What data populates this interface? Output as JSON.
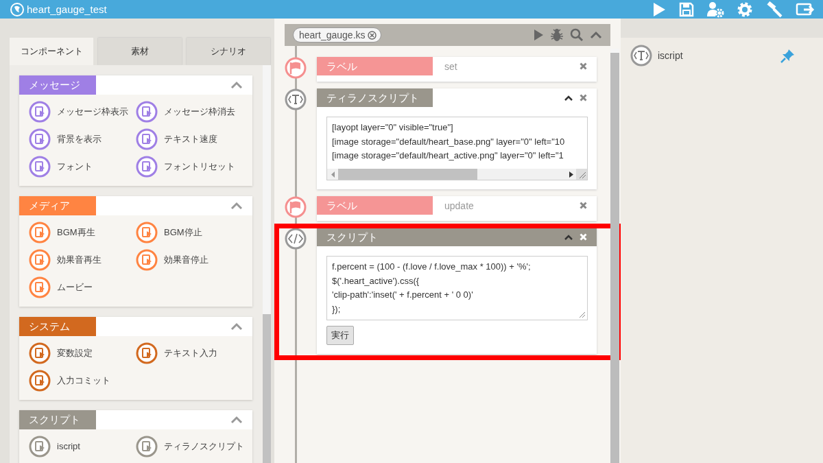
{
  "window": {
    "title": "heart_gauge_test"
  },
  "left_panel": {
    "tabs": [
      {
        "label": "コンポーネント",
        "selected": true
      },
      {
        "label": "素材",
        "selected": false
      },
      {
        "label": "シナリオ",
        "selected": false
      }
    ],
    "sections": [
      {
        "title": "メッセージ",
        "color": "#9f7fe5",
        "expanded": true,
        "items": [
          "メッセージ枠表示",
          "メッセージ枠消去",
          "背景を表示",
          "テキスト速度",
          "フォント",
          "フォントリセット"
        ]
      },
      {
        "title": "メディア",
        "color": "#ff8442",
        "expanded": true,
        "items": [
          "BGM再生",
          "BGM停止",
          "効果音再生",
          "効果音停止",
          "ムービー"
        ]
      },
      {
        "title": "システム",
        "color": "#d2691f",
        "expanded": true,
        "items": [
          "変数設定",
          "テキスト入力",
          "入力コミット"
        ]
      },
      {
        "title": "スクリプト",
        "color": "#9a968c",
        "expanded": true,
        "items": [
          "iscript",
          "ティラノスクリプト"
        ]
      }
    ]
  },
  "editor": {
    "file_tab": {
      "name": "heart_gauge.ks"
    },
    "blocks": [
      {
        "kind": "label",
        "title": "ラベル",
        "value": "set"
      },
      {
        "kind": "tyrano",
        "title": "ティラノスクリプト",
        "selected": false,
        "highlighted": false,
        "code": [
          "[layopt layer=\"0\" visible=\"true\"]",
          "[image storage=\"default/heart_base.png\" layer=\"0\" left=\"10",
          "[image storage=\"default/heart_active.png\" layer=\"0\" left=\"1"
        ]
      },
      {
        "kind": "label",
        "title": "ラベル",
        "value": "update"
      },
      {
        "kind": "iscript",
        "title": "スクリプト",
        "selected": true,
        "highlighted": true,
        "code": [
          "f.percent = (100 - (f.love / f.love_max * 100)) + '%';",
          "$('.heart_active').css({",
          "'clip-path':'inset(' + f.percent + ' 0 0)'",
          "});"
        ],
        "button": "実行"
      }
    ]
  },
  "right_panel": {
    "items": [
      {
        "label": "iscript"
      }
    ]
  }
}
